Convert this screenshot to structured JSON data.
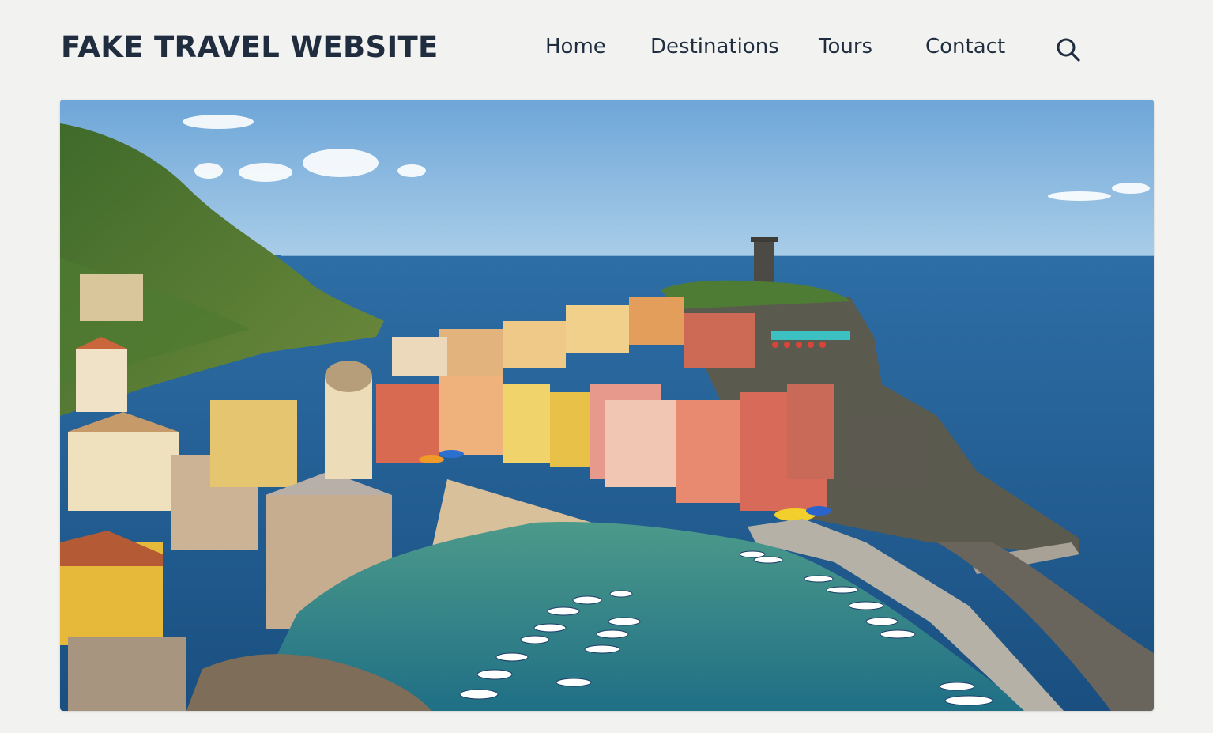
{
  "site": {
    "brand": "FAKE TRAVEL WEBSITE"
  },
  "nav": {
    "items": [
      {
        "label": "Home"
      },
      {
        "label": "Destinations"
      },
      {
        "label": "Tours"
      },
      {
        "label": "Contact"
      }
    ],
    "search_icon": "search-icon"
  },
  "hero": {
    "image": "coastal-village-harbor-photo"
  },
  "colors": {
    "text": "#1f2d3f",
    "background": "#f2f2f1",
    "sky": "#7fb0dc",
    "sea": "#1f5f93",
    "harbor": "#2f8a8a"
  }
}
